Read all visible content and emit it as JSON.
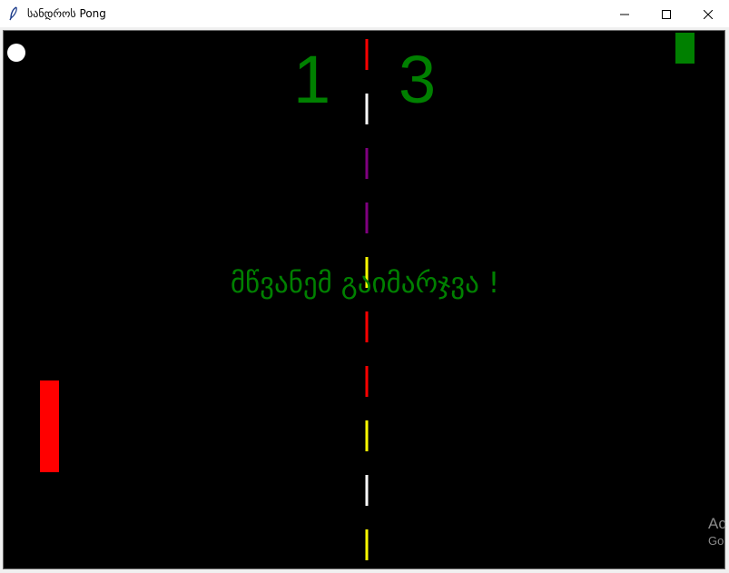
{
  "window": {
    "title": "სანდროს Pong",
    "icon": "feather-icon",
    "controls": [
      "minimize-icon",
      "maximize-icon",
      "close-icon"
    ]
  },
  "game": {
    "score_left": "1",
    "score_right": "3",
    "message": "მწვანემ გაიმარჯვა !",
    "colors": {
      "background": "#000000",
      "left_paddle": "#ff0000",
      "right_paddle": "#008000",
      "ball": "#ffffff",
      "score_text": "#008000",
      "message_text": "#008000"
    },
    "center_line_segment_colors": [
      "#ff0000",
      "#ffffff",
      "#800080",
      "#800080",
      "#ffff00",
      "#ff0000",
      "#ff0000",
      "#ffff00",
      "#ffffff",
      "#ffff00"
    ]
  },
  "watermark": {
    "line1": "Ac",
    "line2": "Go"
  }
}
